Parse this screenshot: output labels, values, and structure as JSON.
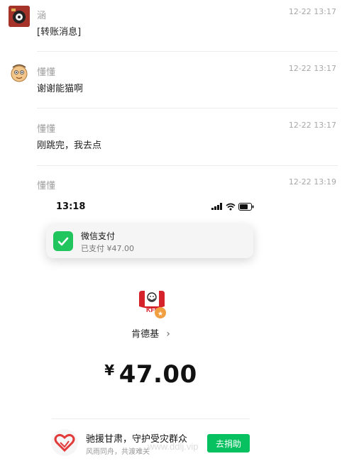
{
  "messages": [
    {
      "sender": "涵",
      "time": "12-22 13:17",
      "text": "[转账消息]"
    },
    {
      "sender": "懂懂",
      "time": "12-22 13:17",
      "text": "谢谢能猫啊"
    },
    {
      "sender": "懂懂",
      "time": "12-22 13:17",
      "text": "刚跳完，我去点"
    },
    {
      "sender": "懂懂",
      "time": "12-22 13:19",
      "text": ""
    }
  ],
  "screenshot": {
    "status_time": "13:18",
    "notification": {
      "app": "微信支付",
      "body": "已支付 ¥47.00",
      "icon": "wechat-pay-icon"
    },
    "merchant": "肯德基",
    "merchant_arrow": "›",
    "currency": "¥",
    "amount": "47.00",
    "charity": {
      "title": "驰援甘肃，守护受灾群众",
      "subtitle": "风雨同舟，共渡难关",
      "button": "去捐助"
    }
  },
  "watermark": "www.ddlj.vip",
  "colors": {
    "wechat_green": "#07c160",
    "kfc_red": "#d6232b"
  }
}
